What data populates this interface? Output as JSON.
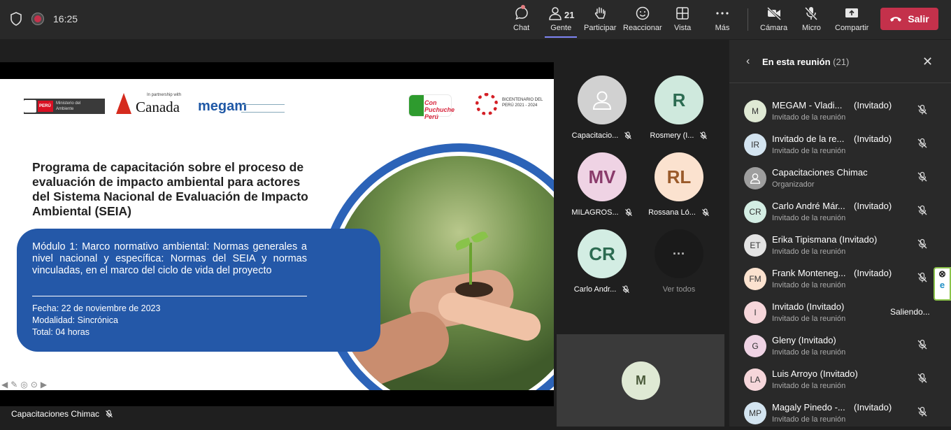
{
  "topbar": {
    "time": "16:25",
    "buttons": {
      "chat": "Chat",
      "people": "Gente",
      "people_count": "21",
      "raise": "Participar",
      "react": "Reaccionar",
      "view": "Vista",
      "more": "Más",
      "camera": "Cámara",
      "mic": "Micro",
      "share": "Compartir"
    },
    "leave_label": "Salir"
  },
  "slide": {
    "partner_text": "In partnership with",
    "canada": "Canada",
    "megam": "megam",
    "peru_ministry": "Ministerio del Ambiente",
    "peru_label": "PERÚ",
    "puchuche": "Con Puchuche Perú",
    "bicentenario": "BICENTENARIO DEL PERÚ 2021 - 2024",
    "title": "Programa de capacitación sobre el proceso de evaluación de impacto ambiental para actores del Sistema Nacional de Evaluación de Impacto Ambiental (SEIA)",
    "module": "Módulo 1: Marco normativo ambiental: Normas generales a nivel nacional y específica: Normas del SEIA y normas vinculadas, en el marco del ciclo de vida del proyecto",
    "date": "Fecha: 22 de noviembre de 2023",
    "mode": "Modalidad: Sincrónica",
    "total": "Total: 04 horas"
  },
  "presenter": "Capacitaciones Chimac",
  "tiles": [
    {
      "initials": "",
      "name": "Capacitacio...",
      "color": "#d1d1d1"
    },
    {
      "initials": "R",
      "name": "Rosmery (I...",
      "color": "#cfe9dd"
    },
    {
      "initials": "MV",
      "name": "MILAGROS...",
      "color": "#efd3e4"
    },
    {
      "initials": "RL",
      "name": "Rossana Ló...",
      "color": "#fbe2cf"
    },
    {
      "initials": "CR",
      "name": "Carlo Andr...",
      "color": "#d3ede3"
    },
    {
      "initials": "···",
      "name": "Ver todos",
      "color": "#1a1a1a"
    }
  ],
  "self_view": {
    "initials": "M"
  },
  "panel": {
    "title": "En esta reunión",
    "count": "(21)",
    "participants": [
      {
        "initials": "M",
        "name": "MEGAM - Vladi...",
        "tag": "(Invitado)",
        "role": "Invitado de la reunión",
        "color": "#dfe9d4"
      },
      {
        "initials": "IR",
        "name": "Invitado de la re...",
        "tag": "(Invitado)",
        "role": "Invitado de la reunión",
        "color": "#d3e4f0"
      },
      {
        "initials": "",
        "name": "Capacitaciones Chimac",
        "tag": "",
        "role": "Organizador",
        "color": "#9e9e9e"
      },
      {
        "initials": "CR",
        "name": "Carlo André Már...",
        "tag": "(Invitado)",
        "role": "Invitado de la reunión",
        "color": "#d3ede3"
      },
      {
        "initials": "ET",
        "name": "Erika Tipismana (Invitado)",
        "tag": "",
        "role": "Invitado de la reunión",
        "color": "#e3e3e3"
      },
      {
        "initials": "FM",
        "name": "Frank Monteneg...",
        "tag": "(Invitado)",
        "role": "Invitado de la reunión",
        "color": "#fbe2cf"
      },
      {
        "initials": "I",
        "name": "Invitado (Invitado)",
        "tag": "",
        "role": "Invitado de la reunión",
        "color": "#f6d6da",
        "status": "Saliendo..."
      },
      {
        "initials": "G",
        "name": "Gleny (Invitado)",
        "tag": "",
        "role": "Invitado de la reunión",
        "color": "#efd3e4"
      },
      {
        "initials": "LA",
        "name": "Luis Arroyo (Invitado)",
        "tag": "",
        "role": "Invitado de la reunión",
        "color": "#f6d6da"
      },
      {
        "initials": "MP",
        "name": "Magaly Pinedo -...",
        "tag": "(Invitado)",
        "role": "Invitado de la reunión",
        "color": "#d3e4f0"
      }
    ]
  }
}
